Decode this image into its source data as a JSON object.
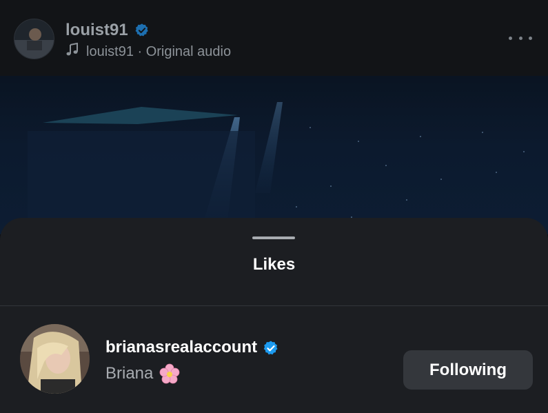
{
  "post": {
    "username": "louist91",
    "audio_text": "louist91 · Original audio",
    "icons": {
      "verified": "verified-badge-icon",
      "audio": "music-note-icon",
      "more": "more-options-icon"
    }
  },
  "likes_sheet": {
    "title": "Likes",
    "rows": [
      {
        "username": "brianasrealaccount",
        "full_name": "Briana",
        "emoji": "🌸",
        "button_label": "Following"
      }
    ]
  },
  "colors": {
    "verified_blue": "#1d9bf0",
    "sheet_bg": "#1c1e22",
    "button_bg": "#34373c"
  }
}
